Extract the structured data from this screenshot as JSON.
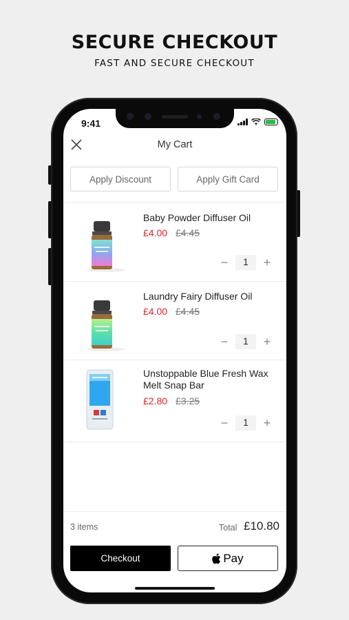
{
  "promo": {
    "title": "SECURE CHECKOUT",
    "subtitle": "FAST AND SECURE CHECKOUT"
  },
  "status_bar": {
    "time": "9:41"
  },
  "header": {
    "title": "My Cart",
    "close_icon": "close-icon"
  },
  "actions": {
    "apply_discount": "Apply Discount",
    "apply_gift_card": "Apply Gift Card"
  },
  "items": [
    {
      "name": "Baby Powder Diffuser Oil",
      "price": "£4.00",
      "was": "£4.45",
      "qty": "1"
    },
    {
      "name": "Laundry Fairy Diffuser Oil",
      "price": "£4.00",
      "was": "£4.45",
      "qty": "1"
    },
    {
      "name": "Unstoppable Blue Fresh Wax Melt Snap Bar",
      "price": "£2.80",
      "was": "£3.25",
      "qty": "1"
    }
  ],
  "footer": {
    "items_count": "3 items",
    "total_label": "Total",
    "total_value": "£10.80",
    "checkout_label": "Checkout",
    "applepay_label": "Pay"
  },
  "colors": {
    "sale_price": "#d7262c",
    "checkout_bg": "#000000",
    "background": "#efefef"
  }
}
